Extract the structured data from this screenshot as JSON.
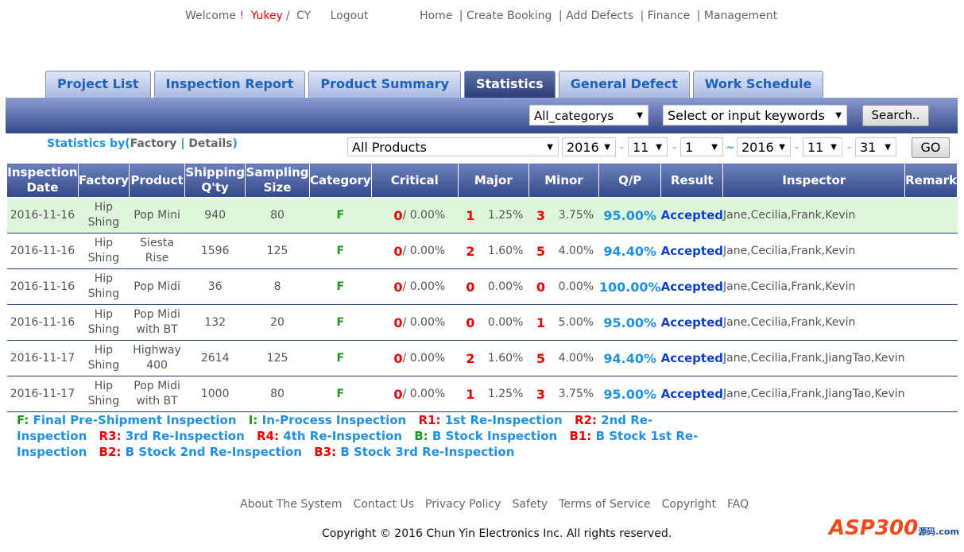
{
  "top": {
    "welcome": "Welcome !",
    "user": "Yukey",
    "sep": "/",
    "org": "CY",
    "logout": "Logout",
    "nav": [
      "Home",
      "Create Booking",
      "Add Defects",
      "Finance",
      "Management"
    ]
  },
  "tabs": [
    "Project List",
    "Inspection Report",
    "Product Summary",
    "Statistics",
    "General Defect",
    "Work Schedule"
  ],
  "search": {
    "category": "All_categorys",
    "keyword": "Select or input keywords",
    "button": "Search.."
  },
  "filter": {
    "statby": "Statistics by(",
    "factory": "Factory",
    "pipe": "|",
    "details": "Details",
    "close": ")",
    "product": "All Products",
    "from": [
      "2016",
      "11",
      "1"
    ],
    "to": [
      "2016",
      "11",
      "31"
    ],
    "dash": "-",
    "tilde": "~",
    "go": "GO"
  },
  "columns": [
    "Inspection Date",
    "Factory",
    "Product",
    "Shipping Q'ty",
    "Sampling Size",
    "Category",
    "Critical",
    "Major",
    "Minor",
    "Q/P",
    "Result",
    "Inspector",
    "Remark"
  ],
  "rows": [
    {
      "date": "2016-11-16",
      "factory": "Hip Shing",
      "product": "Pop Mini",
      "qty": "940",
      "size": "80",
      "cat": "F",
      "crit": "0",
      "critp": "/ 0.00%",
      "maj": "1",
      "majp": "1.25%",
      "min": "3",
      "minp": "3.75%",
      "qp": "95.00%",
      "result": "Accepted",
      "insp": "Jane,Cecilia,Frank,Kevin",
      "remark": ""
    },
    {
      "date": "2016-11-16",
      "factory": "Hip Shing",
      "product": "Siesta Rise",
      "qty": "1596",
      "size": "125",
      "cat": "F",
      "crit": "0",
      "critp": "/ 0.00%",
      "maj": "2",
      "majp": "1.60%",
      "min": "5",
      "minp": "4.00%",
      "qp": "94.40%",
      "result": "Accepted",
      "insp": "Jane,Cecilia,Frank,Kevin",
      "remark": ""
    },
    {
      "date": "2016-11-16",
      "factory": "Hip Shing",
      "product": "Pop Midi",
      "qty": "36",
      "size": "8",
      "cat": "F",
      "crit": "0",
      "critp": "/ 0.00%",
      "maj": "0",
      "majp": "0.00%",
      "min": "0",
      "minp": "0.00%",
      "qp": "100.00%",
      "result": "Accepted",
      "insp": "Jane,Cecilia,Frank,Kevin",
      "remark": ""
    },
    {
      "date": "2016-11-16",
      "factory": "Hip Shing",
      "product": "Pop Midi with BT",
      "qty": "132",
      "size": "20",
      "cat": "F",
      "crit": "0",
      "critp": "/ 0.00%",
      "maj": "0",
      "majp": "0.00%",
      "min": "1",
      "minp": "5.00%",
      "qp": "95.00%",
      "result": "Accepted",
      "insp": "Jane,Cecilia,Frank,Kevin",
      "remark": ""
    },
    {
      "date": "2016-11-17",
      "factory": "Hip Shing",
      "product": "Highway 400",
      "qty": "2614",
      "size": "125",
      "cat": "F",
      "crit": "0",
      "critp": "/ 0.00%",
      "maj": "2",
      "majp": "1.60%",
      "min": "5",
      "minp": "4.00%",
      "qp": "94.40%",
      "result": "Accepted",
      "insp": "Jane,Cecilia,Frank,JiangTao,Kevin",
      "remark": ""
    },
    {
      "date": "2016-11-17",
      "factory": "Hip Shing",
      "product": "Pop Midi with BT",
      "qty": "1000",
      "size": "80",
      "cat": "F",
      "crit": "0",
      "critp": "/ 0.00%",
      "maj": "1",
      "majp": "1.25%",
      "min": "3",
      "minp": "3.75%",
      "qp": "95.00%",
      "result": "Accepted",
      "insp": "Jane,Cecilia,Frank,JiangTao,Kevin",
      "remark": ""
    }
  ],
  "legend": [
    {
      "code": "F:",
      "text": "Final Pre-Shipment Inspection",
      "c": "g"
    },
    {
      "code": "I:",
      "text": "In-Process Inspection",
      "c": "g"
    },
    {
      "code": "R1:",
      "text": "1st Re-Inspection",
      "c": "r"
    },
    {
      "code": "R2:",
      "text": "2nd Re-Inspection",
      "c": "r"
    },
    {
      "code": "R3:",
      "text": "3rd Re-Inspection",
      "c": "r"
    },
    {
      "code": "R4:",
      "text": "4th Re-Inspection",
      "c": "r"
    },
    {
      "code": "B:",
      "text": "B Stock Inspection",
      "c": "g"
    },
    {
      "code": "B1:",
      "text": "B Stock 1st Re-Inspection",
      "c": "r"
    },
    {
      "code": "B2:",
      "text": "B Stock 2nd Re-Inspection",
      "c": "r"
    },
    {
      "code": "B3:",
      "text": "B Stock 3rd Re-Inspection",
      "c": "r"
    }
  ],
  "footer": {
    "links": [
      "About The System",
      "Contact Us",
      "Privacy Policy",
      "Safety",
      "Terms of Service",
      "Copyright",
      "FAQ"
    ],
    "copyright": "Copyright © 2016 Chun Yin Electronics Inc. All rights reserved."
  },
  "logo": {
    "text": "ASP300",
    "sub": "源码 .com"
  }
}
